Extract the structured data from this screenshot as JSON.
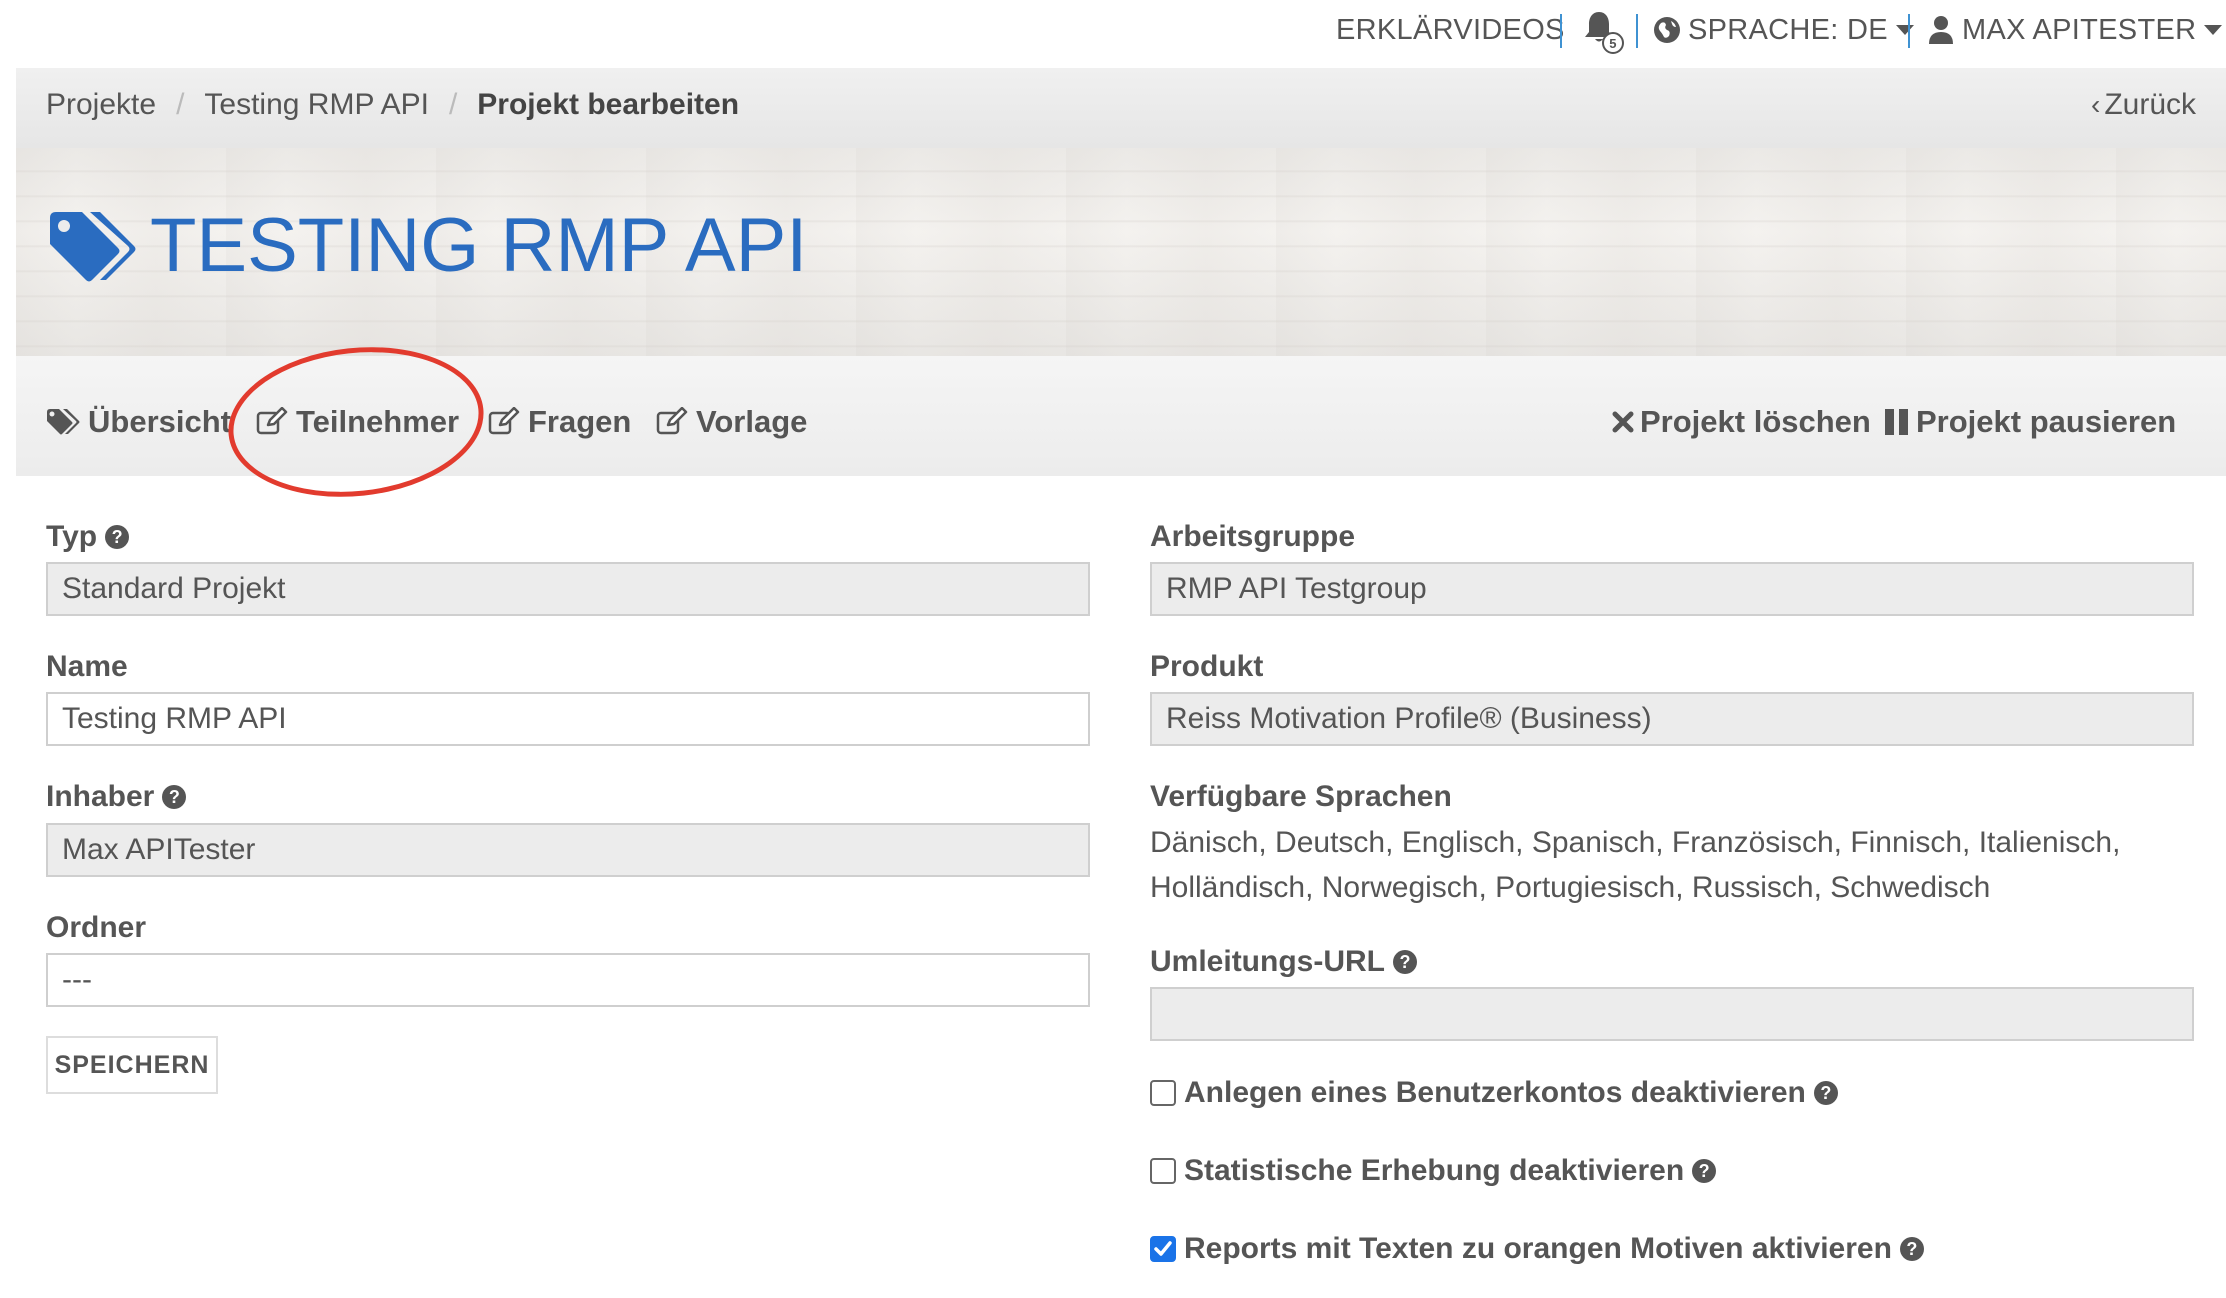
{
  "topbar": {
    "videos": "ERKLÄRVIDEOS",
    "notification_count": "5",
    "language": "SPRACHE: DE",
    "user": "MAX APITESTER"
  },
  "breadcrumb": {
    "items": [
      "Projekte",
      "Testing RMP API",
      "Projekt bearbeiten"
    ],
    "back": "Zurück"
  },
  "header": {
    "title": "TESTING RMP API"
  },
  "tabs": {
    "overview": "Übersicht",
    "participants": "Teilnehmer",
    "questions": "Fragen",
    "template": "Vorlage",
    "delete": "Projekt löschen",
    "pause": "Projekt pausieren"
  },
  "form": {
    "type_label": "Typ",
    "type_value": "Standard Projekt",
    "name_label": "Name",
    "name_value": "Testing RMP API",
    "owner_label": "Inhaber",
    "owner_value": "Max APITester",
    "folder_label": "Ordner",
    "folder_value": "---",
    "save_button": "SPEICHERN",
    "group_label": "Arbeitsgruppe",
    "group_value": "RMP API Testgroup",
    "product_label": "Produkt",
    "product_value": "Reiss Motivation Profile® (Business)",
    "languages_label": "Verfügbare Sprachen",
    "languages_value": "Dänisch, Deutsch, Englisch, Spanisch, Französisch, Finnisch, Italienisch, Holländisch, Norwegisch, Portugiesisch, Russisch, Schwedisch",
    "redirect_label": "Umleitungs-URL",
    "redirect_value": "",
    "checkbox_account": "Anlegen eines Benutzerkontos deaktivieren",
    "checkbox_stats": "Statistische Erhebung deaktivieren",
    "checkbox_reports": "Reports mit Texten zu orangen Motiven aktivieren",
    "checkbox_account_checked": false,
    "checkbox_stats_checked": false,
    "checkbox_reports_checked": true
  },
  "colors": {
    "accent": "#2a6cc0",
    "highlight_ring": "#e23b2e",
    "checkbox_checked": "#1a73e8"
  }
}
